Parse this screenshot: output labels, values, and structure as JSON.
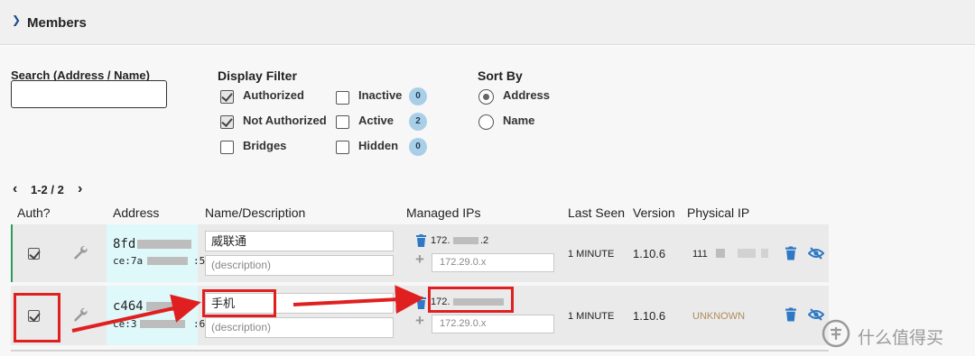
{
  "section": {
    "title": "Members"
  },
  "search": {
    "label": "Search (Address / Name)",
    "value": ""
  },
  "display_filter": {
    "title": "Display Filter",
    "options": [
      {
        "label": "Authorized",
        "checked": true
      },
      {
        "label": "Not Authorized",
        "checked": true
      },
      {
        "label": "Bridges",
        "checked": false
      },
      {
        "label": "Inactive",
        "checked": false,
        "count": "0"
      },
      {
        "label": "Active",
        "checked": false,
        "count": "2"
      },
      {
        "label": "Hidden",
        "checked": false,
        "count": "0"
      }
    ]
  },
  "sort_by": {
    "title": "Sort By",
    "options": [
      {
        "label": "Address",
        "selected": true
      },
      {
        "label": "Name",
        "selected": false
      }
    ]
  },
  "pager": {
    "prev": "‹",
    "range": "1-2 / 2",
    "next": "›"
  },
  "columns": [
    "Auth?",
    "Address",
    "Name/Description",
    "Managed IPs",
    "Last Seen",
    "Version",
    "Physical IP"
  ],
  "members": [
    {
      "authorized": true,
      "address_line1": "8fd",
      "address_line2": "ce:7a",
      "address_suffix": ":5",
      "name": "威联通",
      "description_placeholder": "(description)",
      "managed_ip": "172.",
      "managed_ip_suffix": ".2",
      "ip_placeholder": "172.29.0.x",
      "last_seen": "1 MINUTE",
      "version": "1.10.6",
      "physical_ip": "111"
    },
    {
      "authorized": true,
      "address_line1": "c464",
      "address_line2": "ce:3",
      "address_suffix": ":6",
      "name": "手机",
      "description_placeholder": "(description)",
      "managed_ip": "172.",
      "managed_ip_suffix": "",
      "ip_placeholder": "172.29.0.x",
      "last_seen": "1 MINUTE",
      "version": "1.10.6",
      "physical_ip": "UNKNOWN"
    }
  ],
  "colors": {
    "accent": "#1a4f8b",
    "delete_icon": "#2e78c4",
    "annotation": "#e02020",
    "unknown_text": "#b08c5a",
    "address_highlight": "#dff8fa"
  },
  "watermark": {
    "text": "什么值得买",
    "icon": "smzdm-logo-icon"
  }
}
